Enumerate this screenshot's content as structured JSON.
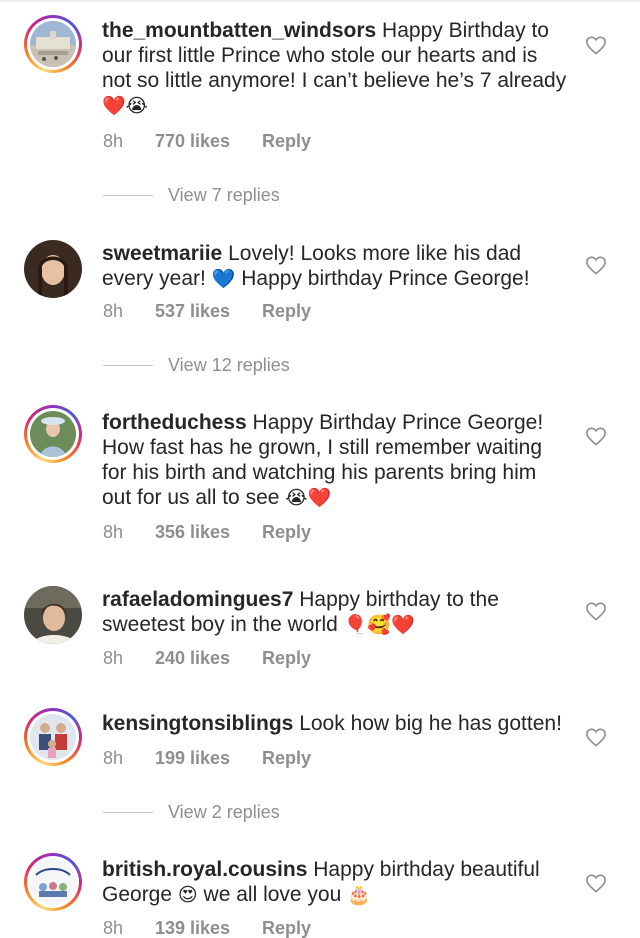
{
  "comments": [
    {
      "username": "the_mountbatten_windsors",
      "text": "Happy Birthday to our first little Prince who stole our hearts and is not so little anymore! I can’t believe he’s 7 already",
      "emoji": "❤️😭",
      "time": "8h",
      "likes": "770 likes",
      "reply": "Reply",
      "view_replies": "View 7 replies",
      "avatar_icon": "palace-photo-icon"
    },
    {
      "username": "sweetmariie",
      "text_a": "Lovely! Looks more like his dad every year!",
      "emoji": "💙",
      "text_b": "Happy birthday Prince George!",
      "time": "8h",
      "likes": "537 likes",
      "reply": "Reply",
      "view_replies": "View 12 replies",
      "avatar_icon": "woman-portrait-icon"
    },
    {
      "username": "fortheduchess",
      "text": "Happy Birthday Prince George! How fast has he grown, I still remember waiting for his birth and watching his parents bring him out for us all to see",
      "emoji": "😭❤️",
      "time": "8h",
      "likes": "356 likes",
      "reply": "Reply",
      "avatar_icon": "duchess-photo-icon"
    },
    {
      "username": "rafaeladomingues7",
      "text": "Happy birthday to the sweetest boy in the world",
      "emoji": "🎈🥰❤️",
      "time": "8h",
      "likes": "240 likes",
      "reply": "Reply",
      "avatar_icon": "woman-photo-icon"
    },
    {
      "username": "kensingtonsiblings",
      "text": "Look how big he has gotten!",
      "time": "8h",
      "likes": "199 likes",
      "reply": "Reply",
      "view_replies": "View 2 replies",
      "avatar_icon": "family-photo-icon"
    },
    {
      "username": "british.royal.cousins",
      "text_a": "Happy birthday beautiful George",
      "emoji": "😍",
      "text_b": "we all love you",
      "emoji_b": "🎂",
      "time": "8h",
      "likes": "139 likes",
      "reply": "Reply",
      "avatar_icon": "cousins-logo-icon"
    }
  ],
  "colors": {
    "text": "#262626",
    "meta": "#8e8e8e",
    "heart": "#d9302f",
    "blue_heart": "#3897f0"
  }
}
